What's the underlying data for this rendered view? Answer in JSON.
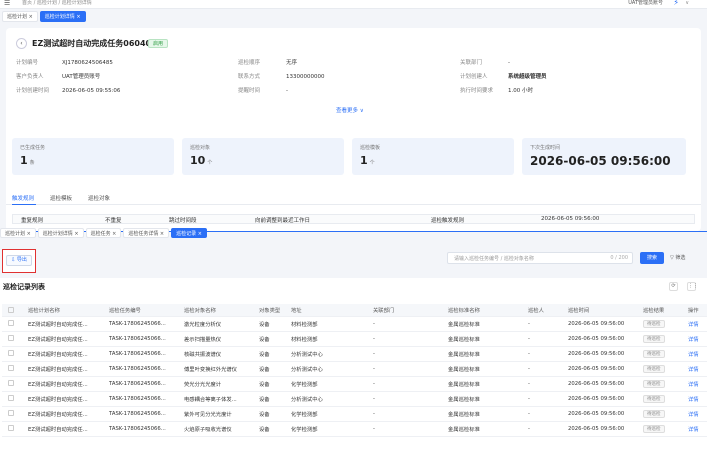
{
  "topbar": {
    "breadcrumb": "首页 / 巡检计划 / 巡检计划详情",
    "user": "UAT管理员账号"
  },
  "tabs1": [
    {
      "label": "巡检计划 ×"
    },
    {
      "label": "巡检计划详情 ×"
    }
  ],
  "detail": {
    "title": "EZ测试超时自动完成任务060401",
    "status": "启用",
    "fields": [
      {
        "k": "计划编号",
        "v": "XJ1780624506485"
      },
      {
        "k": "巡检顺序",
        "v": "无序"
      },
      {
        "k": "关联部门",
        "v": "-"
      },
      {
        "k": "客户负责人",
        "v": "UAT管理员账号"
      },
      {
        "k": "联系方式",
        "v": "13300000000"
      },
      {
        "k": "计划创建人",
        "v": "系统超级管理员"
      },
      {
        "k": "计划创建时间",
        "v": "2026-06-05 09:55:06"
      },
      {
        "k": "提醒时间",
        "v": "-"
      },
      {
        "k": "执行时间要求",
        "v": "1.00 小时"
      }
    ],
    "more": "查看更多 ∨"
  },
  "stats": [
    {
      "label": "已生成任务",
      "value": "1",
      "unit": "条"
    },
    {
      "label": "巡检对象",
      "value": "10",
      "unit": "个"
    },
    {
      "label": "巡检模板",
      "value": "1",
      "unit": "个"
    },
    {
      "label": "下次生成时间",
      "value": "2026-06-05 09:56:00",
      "unit": ""
    }
  ],
  "subtabs": [
    "触发规则",
    "巡检模板",
    "巡检对象"
  ],
  "rule_row": [
    "重复规则",
    "不重复",
    "跳过时间段",
    "向前调整到最近工作日",
    "巡检触发规则",
    "2026-06-05 09:56:00"
  ],
  "tabs2": [
    {
      "label": "巡检计划 ×"
    },
    {
      "label": "巡检计划详情 ×"
    },
    {
      "label": "巡检任务 ×"
    },
    {
      "label": "巡检任务详情 ×"
    },
    {
      "label": "巡检记录 ×"
    }
  ],
  "toolbar": {
    "export": "⇩ 导出",
    "search_placeholder": "请输入巡检任务编号 / 巡检对象名称",
    "count": "0 / 200",
    "search": "搜索",
    "filter": "▽ 筛选"
  },
  "list": {
    "title": "巡检记录列表",
    "headers": [
      "",
      "巡检计划名称",
      "巡检任务编号",
      "巡检对象名称",
      "对象类型",
      "地址",
      "关联部门",
      "巡检标准名称",
      "巡检人",
      "巡检时间",
      "巡检结果",
      "操作"
    ],
    "rows": [
      [
        "EZ测试超时自动完成任...",
        "TASK-17806245066...",
        "激光粒度分析仪",
        "设备",
        "材料检测部",
        "-",
        "金属巡检标准",
        "-",
        "2026-06-05 09:56:00",
        "待巡检",
        "详情"
      ],
      [
        "EZ测试超时自动完成任...",
        "TASK-17806245066...",
        "差示扫描量热仪",
        "设备",
        "材料检测部",
        "-",
        "金属巡检标准",
        "-",
        "2026-06-05 09:56:00",
        "待巡检",
        "详情"
      ],
      [
        "EZ测试超时自动完成任...",
        "TASK-17806245066...",
        "核磁共振波谱仪",
        "设备",
        "分析测试中心",
        "-",
        "金属巡检标准",
        "-",
        "2026-06-05 09:56:00",
        "待巡检",
        "详情"
      ],
      [
        "EZ测试超时自动完成任...",
        "TASK-17806245066...",
        "傅里叶变换红外光谱仪",
        "设备",
        "分析测试中心",
        "-",
        "金属巡检标准",
        "-",
        "2026-06-05 09:56:00",
        "待巡检",
        "详情"
      ],
      [
        "EZ测试超时自动完成任...",
        "TASK-17806245066...",
        "荧光分光光度计",
        "设备",
        "化学检测部",
        "-",
        "金属巡检标准",
        "-",
        "2026-06-05 09:56:00",
        "待巡检",
        "详情"
      ],
      [
        "EZ测试超时自动完成任...",
        "TASK-17806245066...",
        "电感耦合等离子体发...",
        "设备",
        "分析测试中心",
        "-",
        "金属巡检标准",
        "-",
        "2026-06-05 09:56:00",
        "待巡检",
        "详情"
      ],
      [
        "EZ测试超时自动完成任...",
        "TASK-17806245066...",
        "紫外可见分光光度计",
        "设备",
        "化学检测部",
        "-",
        "金属巡检标准",
        "-",
        "2026-06-05 09:56:00",
        "待巡检",
        "详情"
      ],
      [
        "EZ测试超时自动完成任...",
        "TASK-17806245066...",
        "火焰原子吸收光谱仪",
        "设备",
        "化学检测部",
        "-",
        "金属巡检标准",
        "-",
        "2026-06-05 09:56:00",
        "待巡检",
        "详情"
      ]
    ]
  }
}
